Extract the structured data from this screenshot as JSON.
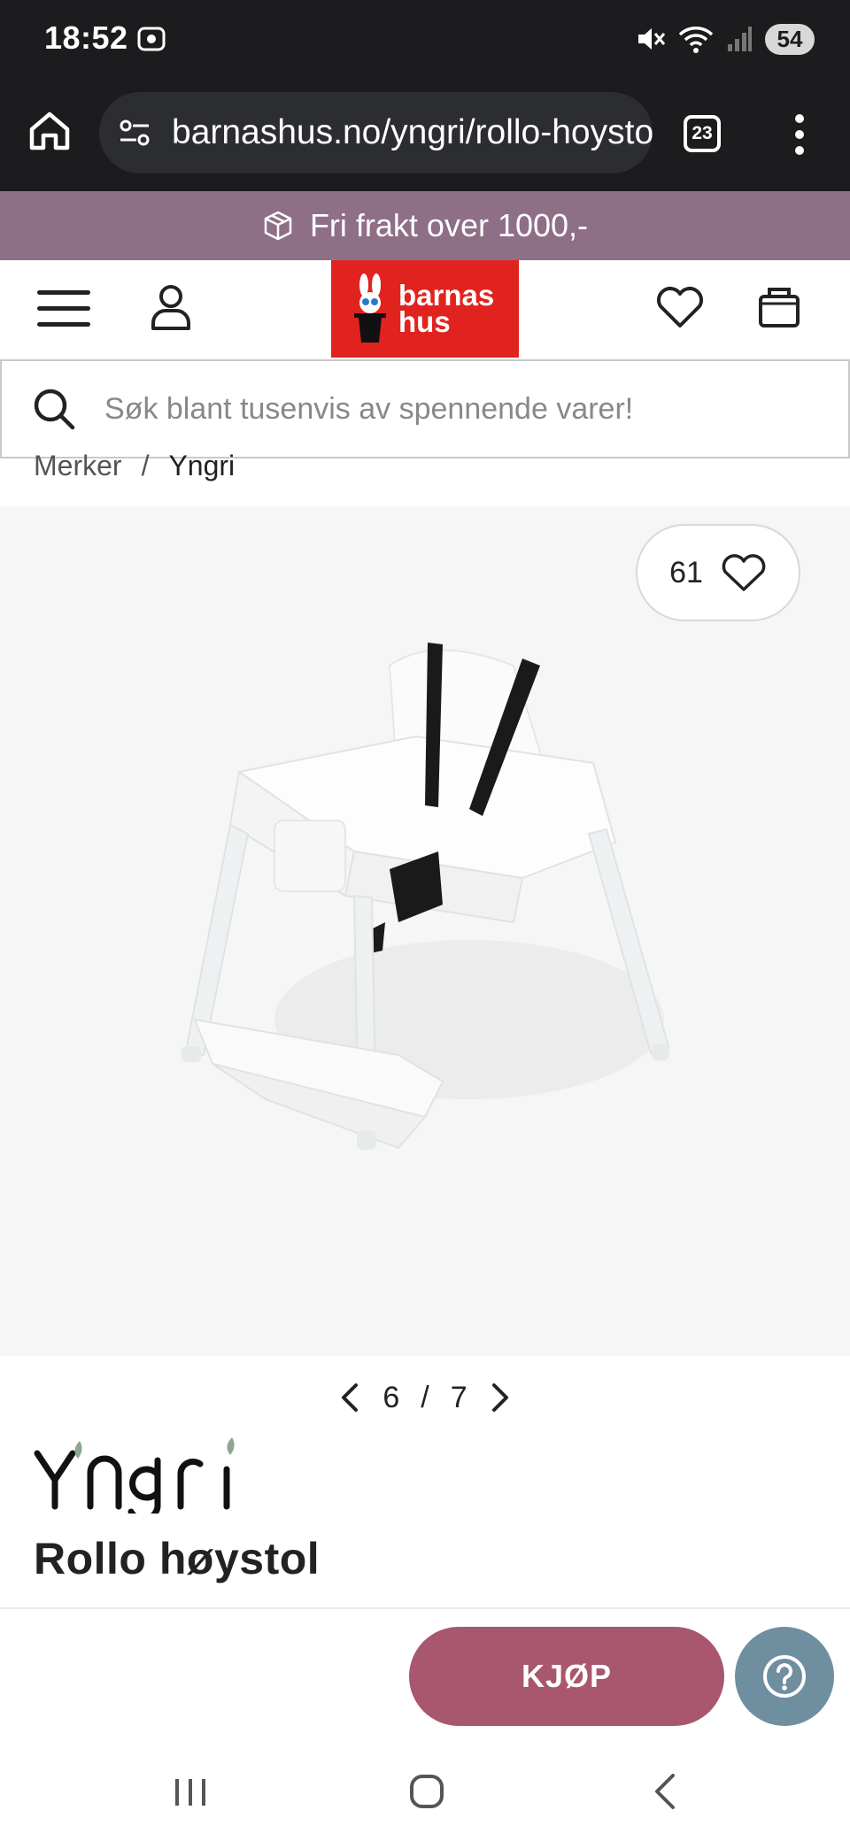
{
  "status_bar": {
    "time": "18:52",
    "battery": "54",
    "icons": [
      "screen-record-icon",
      "mute-icon",
      "wifi-icon",
      "signal-icon"
    ]
  },
  "browser": {
    "url": "barnashus.no/yngri/rollo-hoystol",
    "tab_count": "23",
    "icons": [
      "home-icon",
      "site-settings-icon",
      "tabs-icon",
      "more-icon"
    ]
  },
  "promo": {
    "text": "Fri frakt over 1000,-",
    "icon": "package-icon",
    "color": "#8e6f86"
  },
  "header": {
    "logo_line1": "barnas",
    "logo_line2": "hus",
    "logo_color": "#e1231f",
    "icons": [
      "menu-icon",
      "user-icon",
      "wishlist-icon",
      "cart-icon"
    ]
  },
  "search": {
    "placeholder": "Søk blant tusenvis av spennende varer!"
  },
  "breadcrumb": {
    "parent": "Merker",
    "separator": "/",
    "current": "Yngri"
  },
  "gallery": {
    "favorites_count": "61",
    "current": "6",
    "separator": "/",
    "total": "7",
    "image": "white high chair with black harness"
  },
  "product": {
    "brand": "Yngri",
    "title": "Rollo høystol"
  },
  "actions": {
    "buy_label": "KJØP",
    "buy_color": "#a9566f",
    "help_color": "#6f8fa0"
  },
  "system_nav": {
    "icons": [
      "recents-icon",
      "home-nav-icon",
      "back-icon"
    ]
  }
}
